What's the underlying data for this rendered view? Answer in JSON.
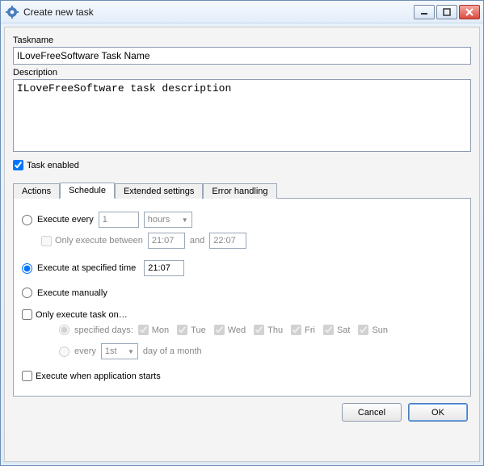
{
  "window": {
    "title": "Create new task"
  },
  "form": {
    "taskname_label": "Taskname",
    "taskname_value": "ILoveFreeSoftware Task Name",
    "description_label": "Description",
    "description_value": "ILoveFreeSoftware task description",
    "task_enabled_label": "Task enabled",
    "task_enabled_checked": true
  },
  "tabs": {
    "actions": "Actions",
    "schedule": "Schedule",
    "extended": "Extended settings",
    "error": "Error handling",
    "active": "schedule"
  },
  "schedule": {
    "execute_every": {
      "label": "Execute every",
      "value": "1",
      "unit": "hours",
      "selected": false,
      "between": {
        "label": "Only execute between",
        "checked": false,
        "from": "21:07",
        "and": "and",
        "to": "22:07"
      }
    },
    "execute_at": {
      "label": "Execute at specified time",
      "time": "21:07",
      "selected": true
    },
    "execute_manually": {
      "label": "Execute manually",
      "selected": false
    },
    "only_on": {
      "label": "Only execute task on…",
      "checked": false,
      "specified_days": {
        "label": "specified days:",
        "selected": true,
        "days": {
          "mon": "Mon",
          "tue": "Tue",
          "wed": "Wed",
          "thu": "Thu",
          "fri": "Fri",
          "sat": "Sat",
          "sun": "Sun"
        }
      },
      "every_nth": {
        "label_prefix": "every",
        "value": "1st",
        "label_suffix": "day of a month",
        "selected": false
      }
    },
    "execute_on_start": {
      "label": "Execute when application starts",
      "checked": false
    }
  },
  "footer": {
    "cancel": "Cancel",
    "ok": "OK"
  }
}
